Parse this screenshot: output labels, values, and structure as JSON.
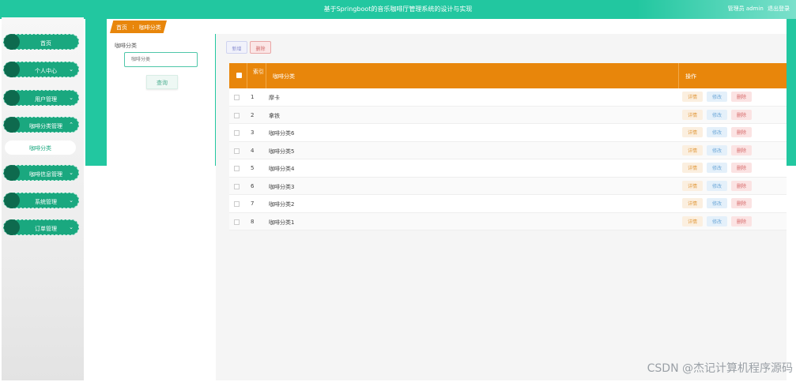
{
  "header": {
    "title": "基于Springboot的音乐咖啡厅管理系统的设计与实现",
    "user_label": "管理员 admin",
    "logout_label": "退出登录"
  },
  "sidebar": {
    "items": [
      {
        "label": "首页",
        "chevron": ""
      },
      {
        "label": "个人中心",
        "chevron": "⌄"
      },
      {
        "label": "用户管理",
        "chevron": "⌄"
      },
      {
        "label": "咖啡分类管理",
        "chevron": "⌃"
      },
      {
        "label": "咖啡信息管理",
        "chevron": "⌄"
      },
      {
        "label": "系统管理",
        "chevron": "⌄"
      },
      {
        "label": "订单管理",
        "chevron": "⌄"
      }
    ],
    "sub_item": "咖啡分类"
  },
  "breadcrumb": {
    "home": "首页",
    "separator": "⁝",
    "current": "咖啡分类"
  },
  "search": {
    "label": "咖啡分类",
    "placeholder": "咖啡分类",
    "button": "查询"
  },
  "toolbar": {
    "add_label": "新增",
    "delete_label": "删除"
  },
  "table": {
    "columns": {
      "index": "索引",
      "name": "咖啡分类",
      "ops": "操作"
    },
    "rows": [
      {
        "index": "1",
        "name": "摩卡"
      },
      {
        "index": "2",
        "name": "拿铁"
      },
      {
        "index": "3",
        "name": "咖啡分类6"
      },
      {
        "index": "4",
        "name": "咖啡分类5"
      },
      {
        "index": "5",
        "name": "咖啡分类4"
      },
      {
        "index": "6",
        "name": "咖啡分类3"
      },
      {
        "index": "7",
        "name": "咖啡分类2"
      },
      {
        "index": "8",
        "name": "咖啡分类1"
      }
    ],
    "row_actions": {
      "detail": "详情",
      "edit": "修改",
      "delete": "删除"
    }
  },
  "watermark": "CSDN @杰记计算机程序源码",
  "colors": {
    "primary": "#22c7a0",
    "accent": "#e8860b",
    "sidebar_item": "#1aa87f"
  }
}
